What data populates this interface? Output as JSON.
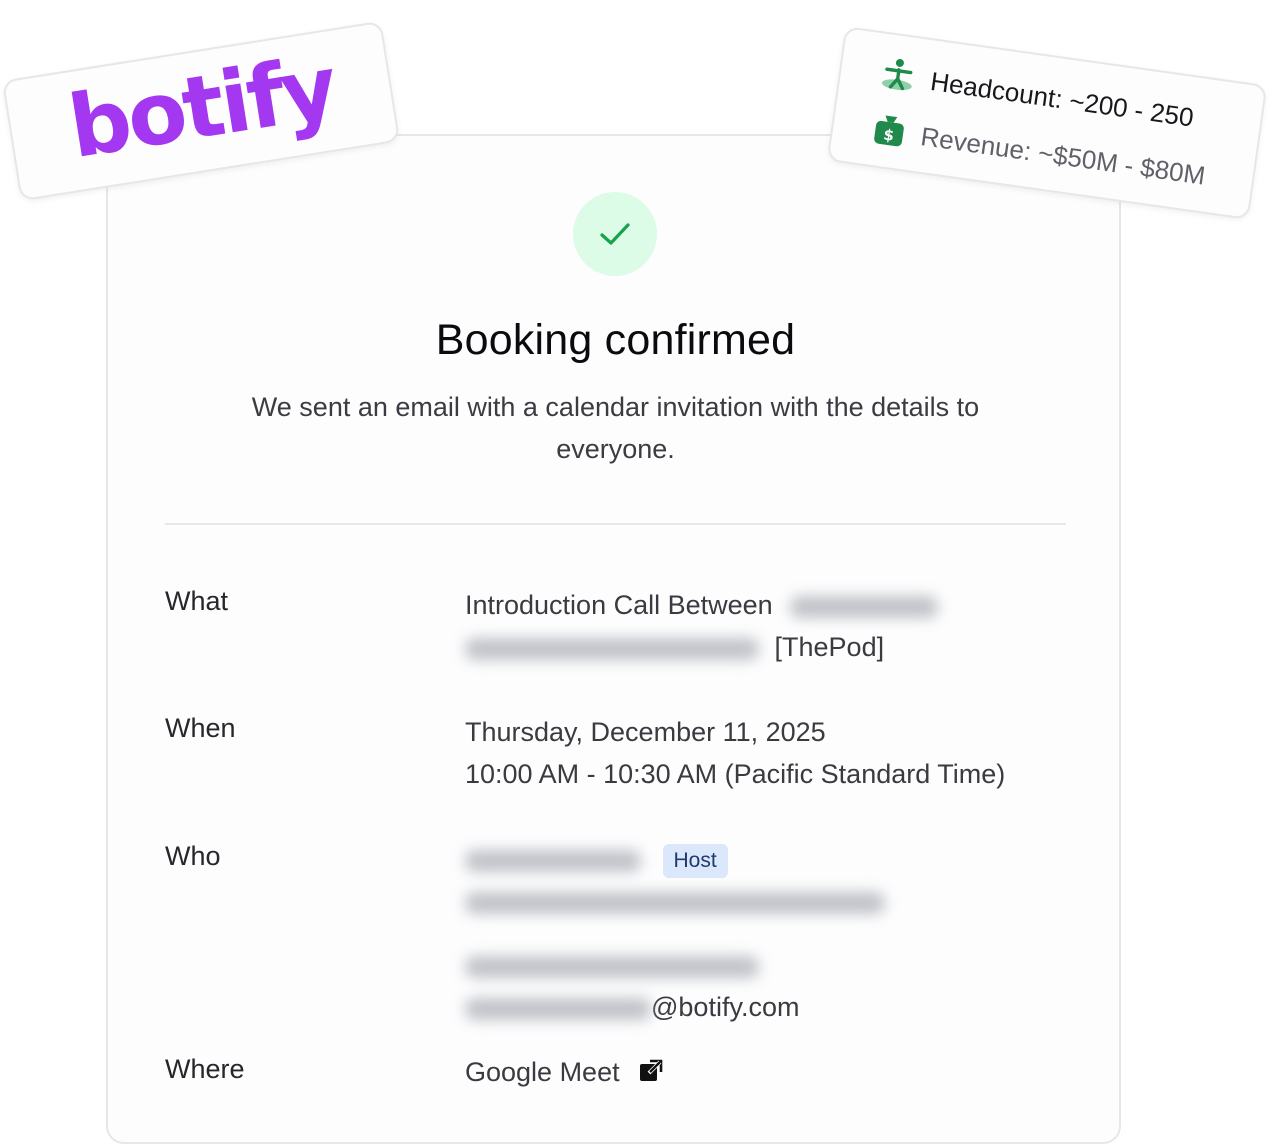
{
  "logo": {
    "text": "botify",
    "color": "#a437f0"
  },
  "stats": {
    "headcount": "Headcount: ~200 - 250",
    "revenue": "Revenue: ~$50M - $80M"
  },
  "status": {
    "icon": "check-icon",
    "title": "Booking confirmed",
    "subtitle": "We sent an email with a calendar invitation with the details to everyone."
  },
  "details": {
    "what": {
      "label": "What",
      "prefix": "Introduction Call Between",
      "suffix": "[ThePod]"
    },
    "when": {
      "label": "When",
      "date": "Thursday, December 11, 2025",
      "time": "10:00 AM - 10:30 AM (Pacific Standard Time)"
    },
    "who": {
      "label": "Who",
      "host_badge": "Host",
      "guest_email_domain": "@botify.com"
    },
    "where": {
      "label": "Where",
      "value": "Google Meet",
      "icon": "external-link-icon"
    }
  },
  "colors": {
    "success_bg": "#dcfce7",
    "success_check": "#16a34a",
    "badge_bg": "#dbe7fb",
    "stat_icon_green": "#1f8a4c"
  }
}
